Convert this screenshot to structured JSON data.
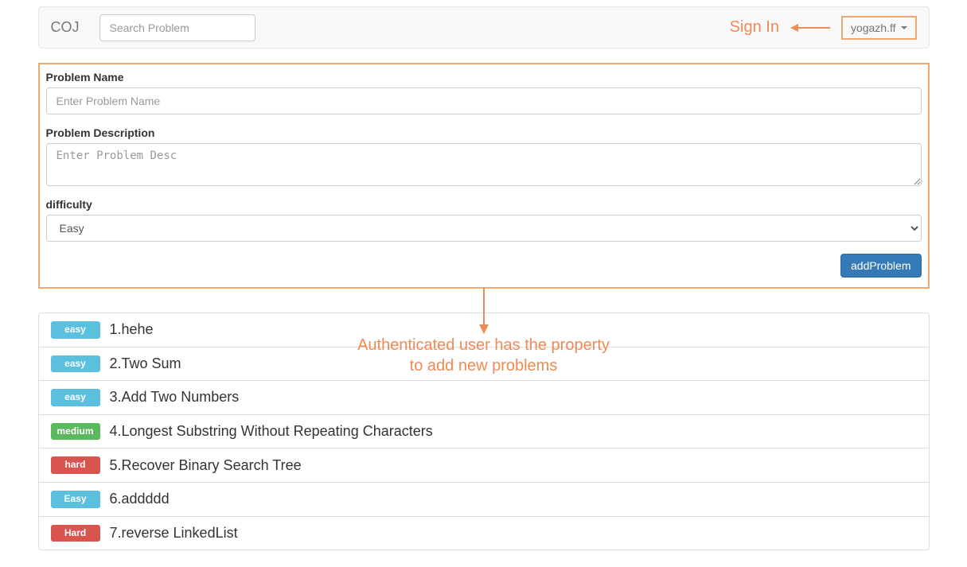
{
  "navbar": {
    "brand": "COJ",
    "search_placeholder": "Search Problem",
    "signin_label": "Sign In",
    "username": "yogazh.ff"
  },
  "form": {
    "name_label": "Problem Name",
    "name_placeholder": "Enter Problem Name",
    "desc_label": "Problem Description",
    "desc_placeholder": "Enter Problem Desc",
    "difficulty_label": "difficulty",
    "difficulty_value": "Easy",
    "submit_label": "addProblem"
  },
  "annotation": {
    "line1": "Authenticated user has the property",
    "line2": "to add new problems"
  },
  "difficulty_colors": {
    "easy": "#5bc0de",
    "medium": "#5cb85c",
    "hard": "#d9534f"
  },
  "problems": [
    {
      "difficulty": "easy",
      "badge_label": "easy",
      "id": 1,
      "title": "hehe"
    },
    {
      "difficulty": "easy",
      "badge_label": "easy",
      "id": 2,
      "title": "Two Sum"
    },
    {
      "difficulty": "easy",
      "badge_label": "easy",
      "id": 3,
      "title": "Add Two Numbers"
    },
    {
      "difficulty": "medium",
      "badge_label": "medium",
      "id": 4,
      "title": "Longest Substring Without Repeating Characters"
    },
    {
      "difficulty": "hard",
      "badge_label": "hard",
      "id": 5,
      "title": "Recover Binary Search Tree"
    },
    {
      "difficulty": "easy",
      "badge_label": "Easy",
      "id": 6,
      "title": "addddd"
    },
    {
      "difficulty": "hard",
      "badge_label": "Hard",
      "id": 7,
      "title": "reverse LinkedList"
    }
  ]
}
